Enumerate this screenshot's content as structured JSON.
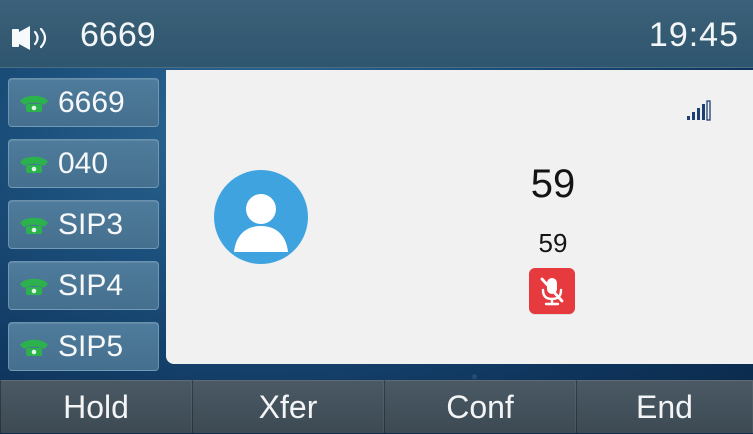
{
  "status_bar": {
    "line_number": "6669",
    "time": "19:45",
    "speaker_icon": "speaker-volume-icon"
  },
  "line_keys": [
    {
      "label": "6669",
      "icon": "phone-handset-icon"
    },
    {
      "label": "040",
      "icon": "phone-handset-icon"
    },
    {
      "label": "SIP3",
      "icon": "phone-handset-icon"
    },
    {
      "label": "SIP4",
      "icon": "phone-handset-icon"
    },
    {
      "label": "SIP5",
      "icon": "phone-handset-icon"
    }
  ],
  "call": {
    "name": "59",
    "number": "59",
    "signal_icon": "signal-strength-icon",
    "avatar_icon": "contact-avatar-icon",
    "mute_icon": "microphone-muted-icon"
  },
  "softkeys": [
    {
      "label": "Hold"
    },
    {
      "label": "Xfer"
    },
    {
      "label": "Conf"
    },
    {
      "label": "End"
    }
  ],
  "colors": {
    "status_bar": "#365c74",
    "line_key": "#4a7696",
    "panel": "#f1f1f1",
    "avatar": "#3fa3e0",
    "mute": "#e63a3f",
    "phone_icon": "#2bb24c"
  }
}
